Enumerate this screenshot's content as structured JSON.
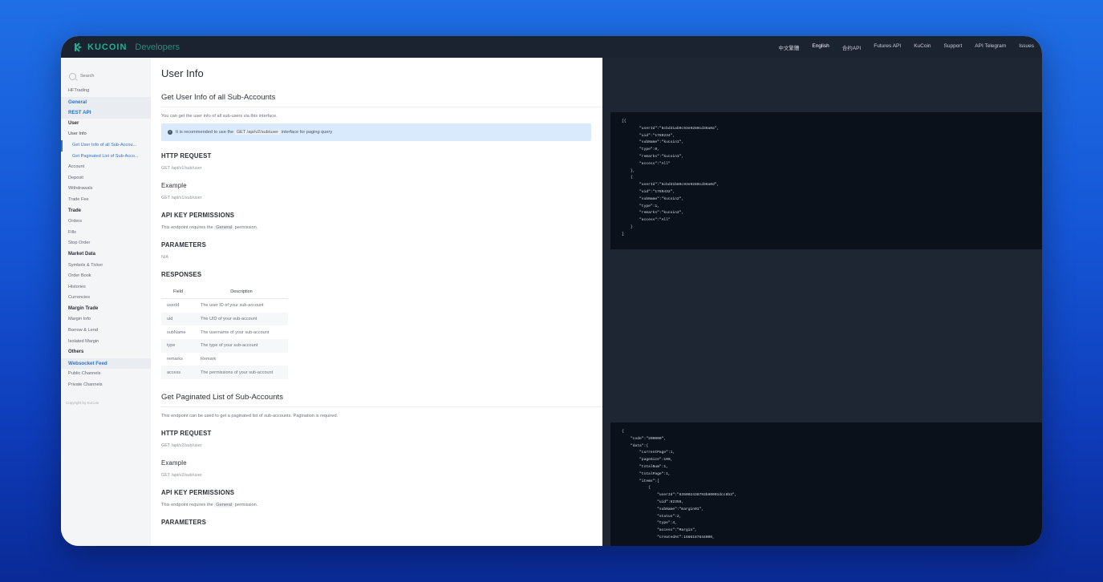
{
  "brand": {
    "logo_text": "KUCOIN",
    "sub_text": "Developers",
    "accent_color": "#24ae8f"
  },
  "topnav": {
    "items": [
      "中文繁體",
      "English",
      "合约API",
      "Futures API",
      "KuCoin",
      "Support",
      "API Telegram",
      "Issues"
    ],
    "active_index": 1
  },
  "sidebar": {
    "search_placeholder": "Search",
    "items": [
      {
        "label": "HFTrading",
        "style": "item"
      },
      {
        "label": "General",
        "style": "hl"
      },
      {
        "label": "REST API",
        "style": "hl"
      },
      {
        "label": "User",
        "style": "section"
      },
      {
        "label": "User Info",
        "style": "plain"
      },
      {
        "label": "Get User Info of all Sub-Accou...",
        "style": "sub-active"
      },
      {
        "label": "Get Paginated List of Sub-Acco...",
        "style": "sub"
      },
      {
        "label": "Account",
        "style": "item"
      },
      {
        "label": "Deposit",
        "style": "item"
      },
      {
        "label": "Withdrawals",
        "style": "item"
      },
      {
        "label": "Trade Fee",
        "style": "item"
      },
      {
        "label": "Trade",
        "style": "section"
      },
      {
        "label": "Orders",
        "style": "item"
      },
      {
        "label": "Fills",
        "style": "item"
      },
      {
        "label": "Stop Order",
        "style": "item"
      },
      {
        "label": "Market Data",
        "style": "section"
      },
      {
        "label": "Symbols & Ticker",
        "style": "item"
      },
      {
        "label": "Order Book",
        "style": "item"
      },
      {
        "label": "Histories",
        "style": "item"
      },
      {
        "label": "Currencies",
        "style": "item"
      },
      {
        "label": "Margin Trade",
        "style": "section"
      },
      {
        "label": "Margin Info",
        "style": "item"
      },
      {
        "label": "Borrow & Lend",
        "style": "item"
      },
      {
        "label": "Isolated Margin",
        "style": "item"
      },
      {
        "label": "Others",
        "style": "section"
      },
      {
        "label": "Websocket Feed",
        "style": "hl"
      },
      {
        "label": "Public Channels",
        "style": "item"
      },
      {
        "label": "Private Channels",
        "style": "item"
      }
    ],
    "footer": "Copyright by KuCoin"
  },
  "content": {
    "title": "User Info",
    "section1": {
      "heading": "Get User Info of all Sub-Accounts",
      "desc": "You can get the user info of all sub-users via this interface.",
      "note_pre": "It is recommended to use the",
      "note_code": "GET /api/v2/sub/user",
      "note_post": "interface for paging query",
      "http_request_label": "HTTP REQUEST",
      "http_request_value": "GET /api/v1/sub/user",
      "example_label": "Example",
      "example_value": "GET /api/v1/sub/user",
      "permissions_label": "API KEY PERMISSIONS",
      "permissions_pre": "This endpoint requires the",
      "permissions_code": "General",
      "permissions_post": "permission.",
      "parameters_label": "PARAMETERS",
      "parameters_value": "N/A",
      "responses_label": "RESPONSES",
      "table_headers": [
        "Field",
        "Description"
      ],
      "table_rows": [
        [
          "userId",
          "The user ID of your sub-account"
        ],
        [
          "uid",
          "The UID of your sub-account"
        ],
        [
          "subName",
          "The username of your sub-account"
        ],
        [
          "type",
          "The type of your sub-account"
        ],
        [
          "remarks",
          "Remark"
        ],
        [
          "access",
          "The permissions of your sub-account"
        ]
      ]
    },
    "section2": {
      "heading": "Get Paginated List of Sub-Accounts",
      "desc": "This endpoint can be used to get a paginated list of sub-accounts. Pagination is required.",
      "http_request_label": "HTTP REQUEST",
      "http_request_value": "GET /api/v2/sub/user",
      "example_label": "Example",
      "example_value": "GET /api/v2/sub/user",
      "permissions_label": "API KEY PERMISSIONS",
      "permissions_pre": "This endpoint requires the",
      "permissions_code": "General",
      "permissions_post": "permission.",
      "parameters_label": "PARAMETERS"
    }
  },
  "code": {
    "block1": [
      "[{",
      "        \"userId\":\"5cbd31ab9c93e9280cd36a0a\",",
      "        \"uid\":\"1789234\",",
      "        \"subName\":\"kucoin1\",",
      "        \"type\":0,",
      "        \"remarks\":\"kucoin1\",",
      "        \"access\":\"All\"",
      "    },",
      "    {",
      "        \"userId\":\"5cbd31b89c93e9280cd36a0d\",",
      "        \"uid\":\"1789432\",",
      "        \"subName\":\"kucoin2\",",
      "        \"type\":1,",
      "        \"remarks\":\"kucoin2\",",
      "        \"access\":\"All\"",
      "    }",
      "]"
    ],
    "block2": [
      "{",
      "    \"code\":\"200000\",",
      "    \"data\":{",
      "        \"currentPage\":1,",
      "        \"pageSize\":100,",
      "        \"totalNum\":1,",
      "        \"totalPage\":1,",
      "        \"items\":[",
      "            {",
      "                \"userId\":\"635002438793b80001dcc8b3\",",
      "                \"uid\":62356,",
      "                \"subName\":\"margin01\",",
      "                \"status\":2,",
      "                \"type\":4,",
      "                \"access\":\"Margin\",",
      "                \"createdAt\":1666187844000,"
    ]
  }
}
